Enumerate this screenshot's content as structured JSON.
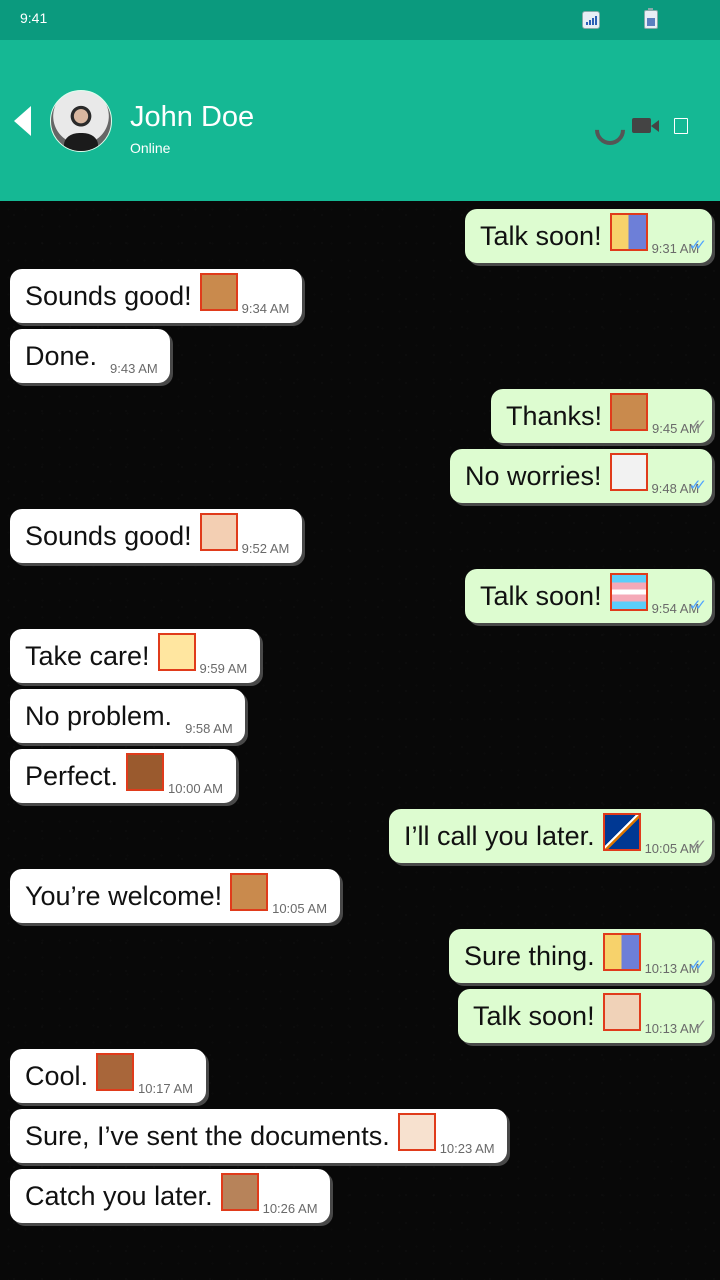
{
  "status": {
    "time": "9:41"
  },
  "contact": {
    "name": "John Doe",
    "presence": "Online"
  },
  "colors": {
    "statusbar": "#0b9a7e",
    "header": "#15b894",
    "chat_bg": "#080808",
    "incoming_bubble": "#ffffff",
    "outgoing_bubble": "#ddfcd0",
    "read_ticks": "#4fa3ff",
    "sent_ticks": "#888888"
  },
  "icons": {
    "back": "chevron-left-icon",
    "phone": "phone-icon",
    "video": "video-camera-icon",
    "more": "more-icon"
  },
  "messages": [
    {
      "dir": "out",
      "text": "Talk soon!",
      "emoji": "person-walking-arrow-right",
      "time": "9:31 AM",
      "ticks": "read"
    },
    {
      "dir": "in",
      "text": "Sounds good!",
      "emoji": "waving-hand",
      "time": "9:34 AM"
    },
    {
      "dir": "in",
      "text": "Done.",
      "emoji": "",
      "time": "9:43 AM"
    },
    {
      "dir": "out",
      "text": "Thanks!",
      "emoji": "couple-with-heart",
      "time": "9:45 AM",
      "ticks": "sent"
    },
    {
      "dir": "out",
      "text": "No worries!",
      "emoji": "person-with-turban",
      "time": "9:48 AM",
      "ticks": "read"
    },
    {
      "dir": "in",
      "text": "Sounds good!",
      "emoji": "ear",
      "time": "9:52 AM"
    },
    {
      "dir": "out",
      "text": "Talk soon!",
      "emoji": "transgender-flag",
      "time": "9:54 AM",
      "ticks": "read"
    },
    {
      "dir": "in",
      "text": "Take care!",
      "emoji": "person-playing-water-polo",
      "time": "9:59 AM"
    },
    {
      "dir": "in",
      "text": "No problem.",
      "emoji": "",
      "time": "9:58 AM"
    },
    {
      "dir": "in",
      "text": "Perfect.",
      "emoji": "index-pointing-up",
      "time": "10:00 AM"
    },
    {
      "dir": "out",
      "text": "I’ll call you later.",
      "emoji": "flag-marshall-islands",
      "time": "10:05 AM",
      "ticks": "sent"
    },
    {
      "dir": "in",
      "text": "You’re welcome!",
      "emoji": "couple-with-heart",
      "time": "10:05 AM"
    },
    {
      "dir": "out",
      "text": "Sure thing.",
      "emoji": "person-walking-arrow-right",
      "time": "10:13 AM",
      "ticks": "read"
    },
    {
      "dir": "out",
      "text": "Talk soon!",
      "emoji": "man-with-bottle",
      "time": "10:13 AM",
      "ticks": "single"
    },
    {
      "dir": "in",
      "text": "Cool.",
      "emoji": "backhand-index-pointing-right",
      "time": "10:17 AM"
    },
    {
      "dir": "in",
      "text": "Sure, I’ve sent the documents.",
      "emoji": "person-in-steamy-room",
      "time": "10:23 AM"
    },
    {
      "dir": "in",
      "text": "Catch you later.",
      "emoji": "person-face",
      "time": "10:26 AM"
    }
  ]
}
